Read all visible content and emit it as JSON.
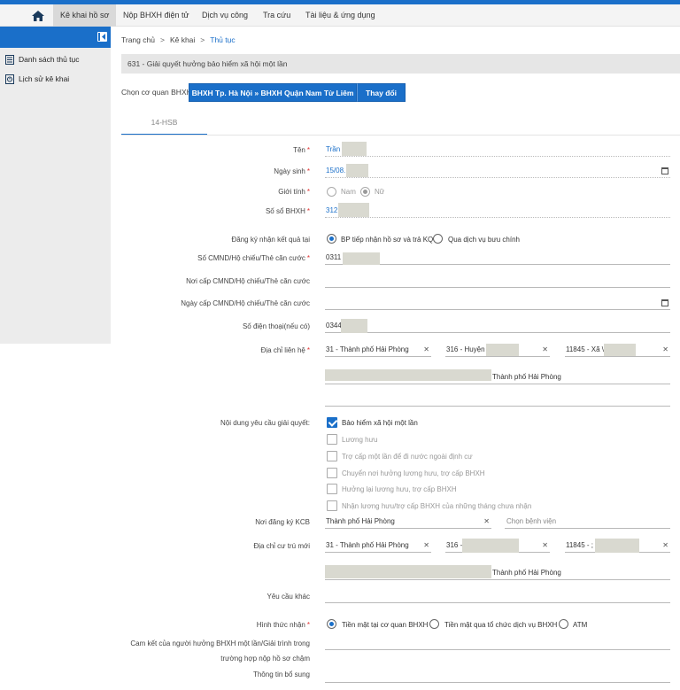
{
  "nav": {
    "items": [
      "Kê khai hồ sơ",
      "Nộp BHXH điện tử",
      "Dịch vụ công",
      "Tra cứu",
      "Tài liệu & ứng dụng"
    ]
  },
  "sidebar": {
    "items": [
      {
        "label": "Danh sách thủ tục",
        "icon": "list-icon"
      },
      {
        "label": "Lịch sử kê khai",
        "icon": "history-icon"
      }
    ]
  },
  "breadcrumb": {
    "home": "Trang chủ",
    "mid": "Kê khai",
    "current": "Thủ tục"
  },
  "procedure_title": "631 - Giải quyết hưởng bảo hiểm xã hội một lần",
  "agency": {
    "label": "Chọn cơ quan BHXH",
    "value": "BHXH Tp. Hà Nội » BHXH Quận Nam Từ Liêm",
    "change": "Thay đổi"
  },
  "tab": "14-HSB",
  "form": {
    "name": {
      "label": "Tên",
      "value": "Trần"
    },
    "dob": {
      "label": "Ngày sinh",
      "value": "15/08."
    },
    "gender": {
      "label": "Giới tính",
      "options": [
        "Nam",
        "Nữ"
      ],
      "selected": "Nữ"
    },
    "social_id": {
      "label": "Số sổ BHXH",
      "value": "312"
    },
    "result_at": {
      "label": "Đăng ký nhận kết quả tại",
      "options": [
        "BP tiếp nhận hồ sơ và trả KQ",
        "Qua dịch vụ bưu chính"
      ],
      "selected": "BP tiếp nhận hồ sơ và trả KQ"
    },
    "id_number": {
      "label": "Số CMND/Hộ chiếu/Thẻ căn cước",
      "value": "0311"
    },
    "id_place": {
      "label": "Nơi cấp CMND/Hộ chiếu/Thẻ căn cước",
      "value": ""
    },
    "id_date": {
      "label": "Ngày cấp CMND/Hộ chiếu/Thẻ căn cước",
      "value": ""
    },
    "phone": {
      "label": "Số điện thoại(nếu có)",
      "value": "0344"
    },
    "contact_address": {
      "label": "Địa chỉ liên hệ",
      "province": "31 - Thành phố Hải Phòng",
      "district": "316 - Huyện '",
      "ward": "11845 - Xã \\",
      "full": "Thành phố Hải Phòng"
    },
    "request": {
      "label": "Nội dung yêu cầu giải quyết:",
      "options": [
        "Bảo hiểm xã hội một lần",
        "Lương hưu",
        "Trợ cấp một lần để đi nước ngoài định cư",
        "Chuyển nơi hưởng lương hưu, trợ cấp BHXH",
        "Hưởng lại lương hưu, trợ cấp BHXH",
        "Nhận lương hưu/trợ cấp BHXH của những tháng chưa nhận"
      ],
      "checked": [
        true,
        false,
        false,
        false,
        false,
        false
      ]
    },
    "kcb": {
      "label": "Nơi đăng ký KCB",
      "value": "Thành phố Hải Phòng",
      "hospital_placeholder": "Chọn bệnh viện"
    },
    "residence": {
      "label": "Địa chỉ cư trú mới",
      "province": "31 - Thành phố Hải Phòng",
      "district": "316 -",
      "ward": "11845 - ;",
      "full": "Thành phố Hải Phòng"
    },
    "other": {
      "label": "Yêu cầu khác",
      "value": ""
    },
    "receive": {
      "label": "Hình thức nhận",
      "options": [
        "Tiền mặt tại cơ quan BHXH",
        "Tiền mặt qua tổ chức dịch vụ BHXH",
        "ATM"
      ],
      "selected": "Tiền mặt tại cơ quan BHXH"
    },
    "commit": {
      "label1": "Cam kết của người hưởng BHXH một lần/Giải trình trong",
      "label2": "trường hợp nộp hồ sơ chậm"
    },
    "extra": {
      "label": "Thông tin bổ sung"
    }
  },
  "colors": {
    "primary": "#1a6fc9",
    "required": "#e03030"
  }
}
